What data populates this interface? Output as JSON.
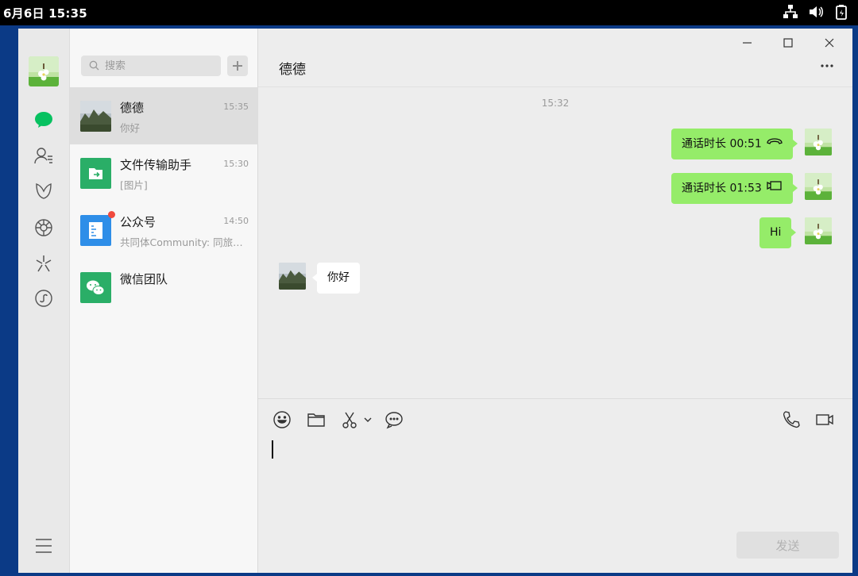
{
  "system_bar": {
    "datetime": "6月6日  15:35",
    "tray_icons": [
      "network-icon",
      "volume-icon",
      "battery-icon"
    ]
  },
  "search": {
    "placeholder": "搜索"
  },
  "chats": [
    {
      "name": "德德",
      "time": "15:35",
      "preview": "你好",
      "active": true,
      "avatar": "landscape-avatar"
    },
    {
      "name": "文件传输助手",
      "time": "15:30",
      "preview": "[图片]",
      "avatar": "file-transfer-icon"
    },
    {
      "name": "公众号",
      "time": "14:50",
      "preview": "共同体Community: 同旅…",
      "avatar": "official-accounts-icon",
      "unread_dot": true
    },
    {
      "name": "微信团队",
      "time": "",
      "preview": "",
      "avatar": "wechat-team-icon"
    }
  ],
  "conversation": {
    "title": "德德",
    "timestamp": "15:32",
    "messages": [
      {
        "direction": "out",
        "text": "通话时长 00:51",
        "icon": "voice-call-icon"
      },
      {
        "direction": "out",
        "text": "通话时长 01:53",
        "icon": "video-call-icon"
      },
      {
        "direction": "out",
        "text": "Hi"
      },
      {
        "direction": "in",
        "text": "你好"
      }
    ],
    "send_label": "发送"
  },
  "colors": {
    "outgoing_bubble": "#95ec69",
    "incoming_bubble": "#ffffff",
    "accent_green": "#07c160",
    "file_transfer_green": "#2aae67",
    "official_blue": "#2e8ee8",
    "unread_red": "#f04a3e"
  }
}
